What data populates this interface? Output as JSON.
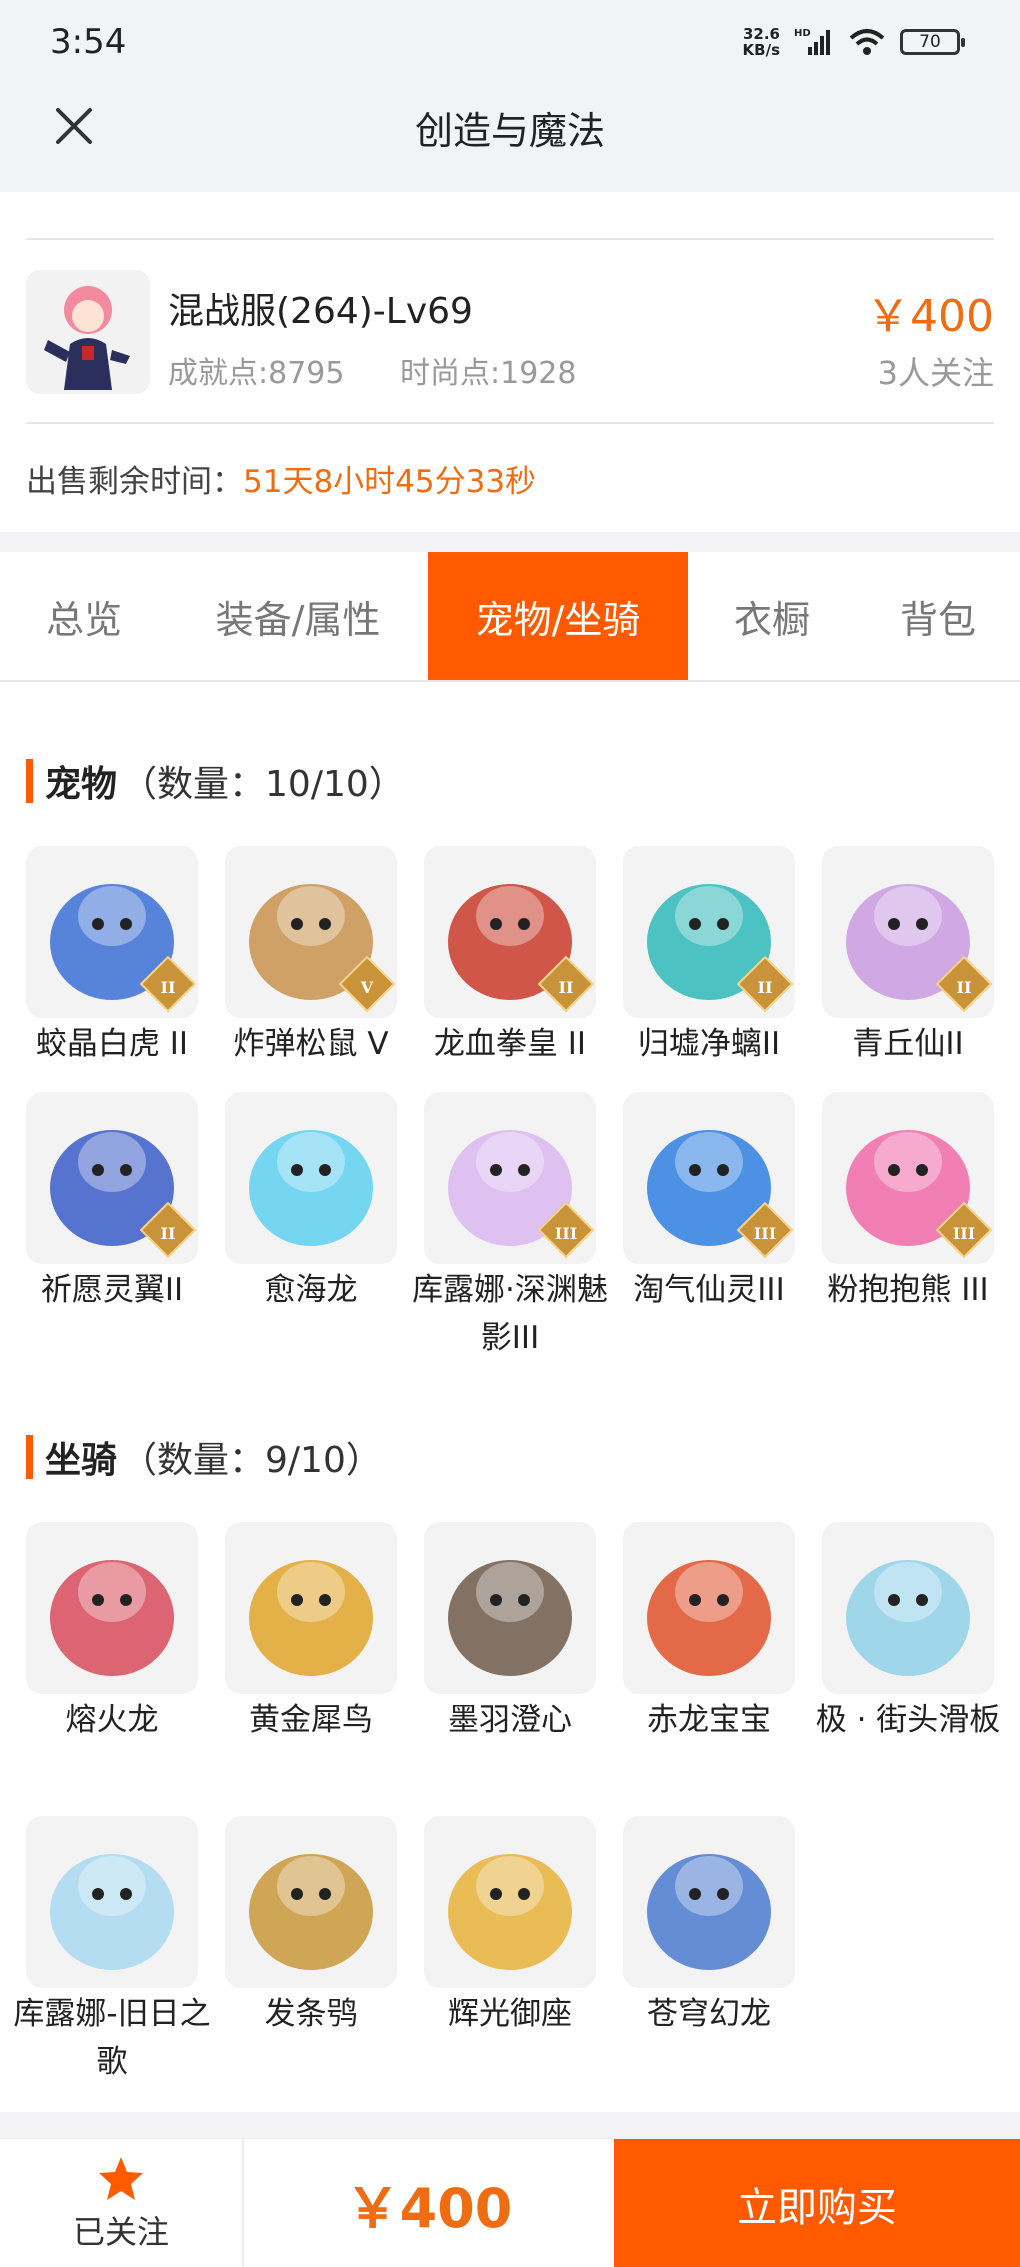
{
  "status": {
    "time": "3:54",
    "net_speed_value": "32.6",
    "net_speed_unit": "KB/s",
    "hd": "HD",
    "battery": "70"
  },
  "header": {
    "title": "创造与魔法"
  },
  "product": {
    "name": "混战服(264)-Lv69",
    "achievement": "成就点:8795",
    "fashion": "时尚点:1928",
    "price": "￥400",
    "followers": "3人关注",
    "sale_time_label": "出售剩余时间：",
    "sale_time_value": "51天8小时45分33秒"
  },
  "tabs": [
    {
      "label": "总览",
      "active": false
    },
    {
      "label": "装备/属性",
      "active": false
    },
    {
      "label": "宠物/坐骑",
      "active": true
    },
    {
      "label": "衣橱",
      "active": false
    },
    {
      "label": "背包",
      "active": false
    }
  ],
  "pets": {
    "title": "宠物",
    "count": "（数量：10/10）",
    "items": [
      {
        "label": "蛟晶白虎 II",
        "color": "#3b6fd6",
        "rank": "II"
      },
      {
        "label": "炸弹松鼠 V",
        "color": "#c8924e",
        "rank": "V"
      },
      {
        "label": "龙血拳皇 II",
        "color": "#c83a2a",
        "rank": "II"
      },
      {
        "label": "归墟净螭II",
        "color": "#2fb8b8",
        "rank": "II"
      },
      {
        "label": "青丘仙II",
        "color": "#c99be0",
        "rank": "II"
      },
      {
        "label": "祈愿灵翼II",
        "color": "#3a5cc9",
        "rank": "II"
      },
      {
        "label": "愈海龙",
        "color": "#5ed0f0",
        "rank": ""
      },
      {
        "label": "库露娜·深渊魅影III",
        "color": "#d9b6f0",
        "rank": "III"
      },
      {
        "label": "淘气仙灵III",
        "color": "#2e7fe0",
        "rank": "III"
      },
      {
        "label": "粉抱抱熊 III",
        "color": "#f06aa8",
        "rank": "III"
      }
    ]
  },
  "mounts": {
    "title": "坐骑",
    "count": "（数量：9/10）",
    "items": [
      {
        "label": "熔火龙",
        "color": "#d84a5a"
      },
      {
        "label": "黄金犀鸟",
        "color": "#e0a52a"
      },
      {
        "label": "墨羽澄心",
        "color": "#6e5a4a"
      },
      {
        "label": "赤龙宝宝",
        "color": "#e0502a"
      },
      {
        "label": "极 · 街头滑板",
        "color": "#8fd0e8"
      },
      {
        "label": "库露娜-旧日之歌",
        "color": "#a8d8f0"
      },
      {
        "label": "发条鸮",
        "color": "#c8963a"
      },
      {
        "label": "辉光御座",
        "color": "#e6b13a"
      },
      {
        "label": "苍穹幻龙",
        "color": "#4a7ad0"
      }
    ]
  },
  "bottom": {
    "follow_label": "已关注",
    "price": "￥400",
    "buy_label": "立即购买"
  },
  "colors": {
    "accent": "#ff5a00",
    "price": "#f06c12"
  }
}
